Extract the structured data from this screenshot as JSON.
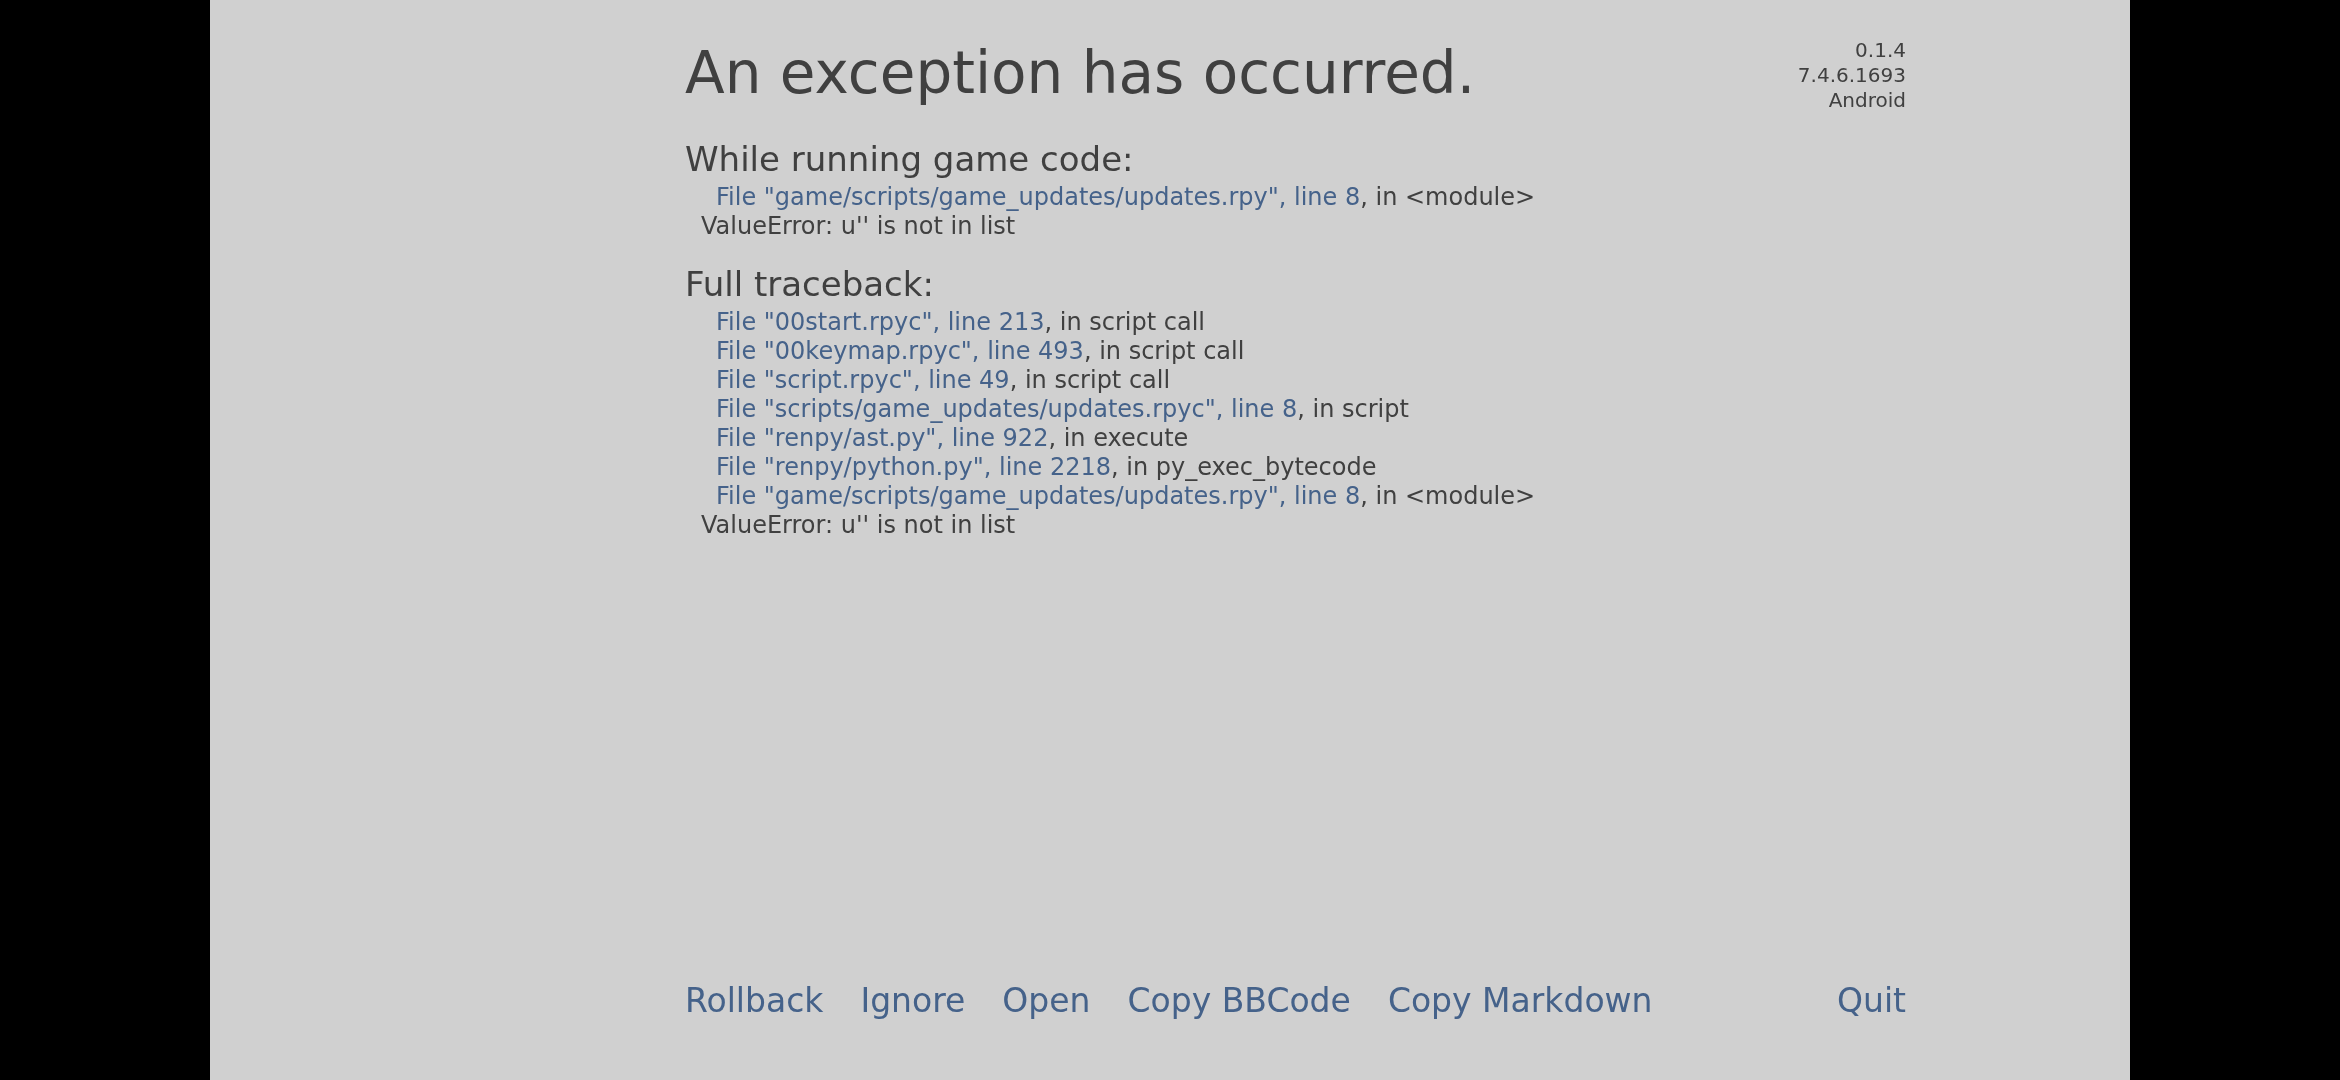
{
  "title": "An exception has occurred.",
  "version_info": [
    "0.1.4",
    "7.4.6.1693",
    "Android"
  ],
  "sections": [
    {
      "heading": "While running game code:",
      "frames": [
        {
          "location": "File \"game/scripts/game_updates/updates.rpy\", line 8",
          "context": ", in <module>"
        }
      ],
      "error": "ValueError: u'' is not in list"
    },
    {
      "heading": "Full traceback:",
      "frames": [
        {
          "location": "File \"00start.rpyc\", line 213",
          "context": ", in script call"
        },
        {
          "location": "File \"00keymap.rpyc\", line 493",
          "context": ", in script call"
        },
        {
          "location": "File \"script.rpyc\", line 49",
          "context": ", in script call"
        },
        {
          "location": "File \"scripts/game_updates/updates.rpyc\", line 8",
          "context": ", in script"
        },
        {
          "location": "File \"renpy/ast.py\", line 922",
          "context": ", in execute"
        },
        {
          "location": "File \"renpy/python.py\", line 2218",
          "context": ", in py_exec_bytecode"
        },
        {
          "location": "File \"game/scripts/game_updates/updates.rpy\", line 8",
          "context": ", in <module>"
        }
      ],
      "error": "ValueError: u'' is not in list"
    }
  ],
  "actions": {
    "left": [
      "Rollback",
      "Ignore",
      "Open",
      "Copy BBCode",
      "Copy Markdown"
    ],
    "right": [
      "Quit"
    ]
  }
}
